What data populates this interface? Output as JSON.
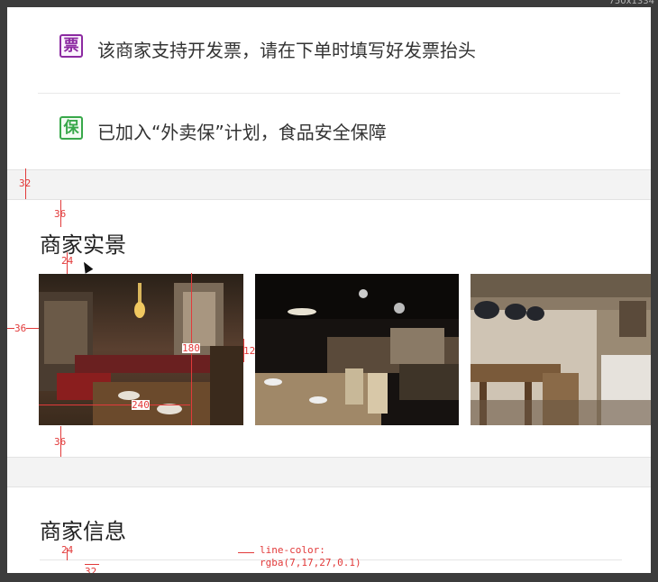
{
  "window": {
    "corner_text": "750x1334"
  },
  "features": [
    {
      "badge": "票",
      "text": "该商家支持开发票，请在下单时填写好发票抬头",
      "color": "#8c2aa1"
    },
    {
      "badge": "保",
      "text": "已加入“外卖保”计划，食品安全保障",
      "color": "#38a84a"
    }
  ],
  "sections": {
    "scene_title": "商家实景",
    "info_title": "商家信息"
  },
  "photos": [
    {
      "label": "restaurant-interior-1",
      "annotation_width": "240",
      "annotation_height": "180"
    },
    {
      "label": "restaurant-interior-2"
    },
    {
      "label": "restaurant-interior-3"
    }
  ],
  "annotations": {
    "gap_height": "32",
    "title_top": "36",
    "title_bottom": "24",
    "photo_left": "36",
    "photo_gap": "12",
    "photo_bottom": "36",
    "info_bottom": "24",
    "info_left": "32",
    "line_color_label": "line-color:",
    "line_color_value": "rgba(7,17,27,0.1)"
  }
}
